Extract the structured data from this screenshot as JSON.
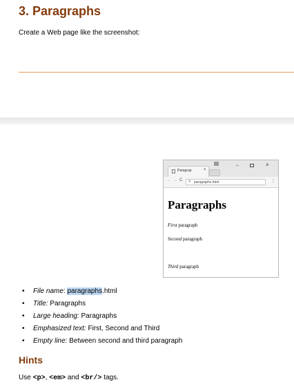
{
  "heading": "3. Paragraphs",
  "intro": "Create a Web page like the screenshot:",
  "browser": {
    "tab_title": "Paragrap",
    "tab_close": "×",
    "win_min": "–",
    "win_close": "×",
    "back": "←",
    "forward": "→",
    "reload": "C",
    "url": "paragraphs.html",
    "menu": "⋮",
    "page_heading": "Paragraphs",
    "p1_em": "First",
    "p1_rest": " paragraph",
    "p2_em": "Second",
    "p2_rest": " paragraph",
    "p3_em": "Third",
    "p3_rest": " paragraph"
  },
  "requirements": [
    {
      "label": "File name",
      "sep": ": ",
      "highlight": "paragraphs",
      "value": ".html"
    },
    {
      "label": "Title:",
      "sep": " ",
      "value": "Paragraphs"
    },
    {
      "label": "Large heading:",
      "sep": " ",
      "value": "Paragraphs"
    },
    {
      "label": "Emphasized text:",
      "sep": " ",
      "value": "First, Second and Third"
    },
    {
      "label": "Empty line:",
      "sep": " ",
      "value": "Between second and third paragraph"
    }
  ],
  "hints": {
    "title": "Hints",
    "use": "Use ",
    "tag1": "<p>",
    "comma": ", ",
    "tag2": "<em>",
    "and": " and ",
    "tag3": "<br/>",
    "end": " tags."
  }
}
